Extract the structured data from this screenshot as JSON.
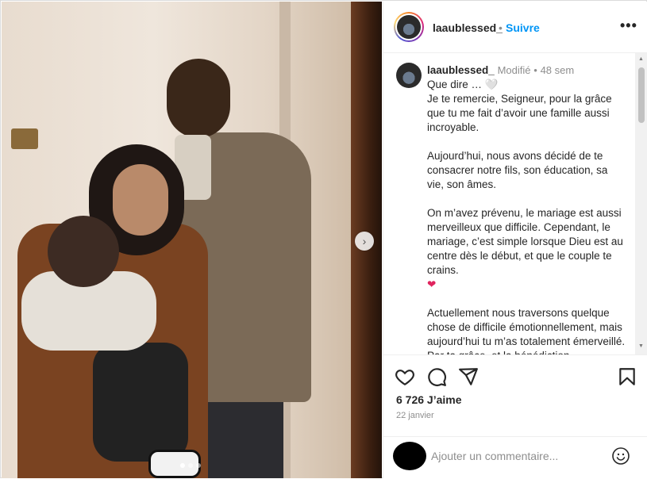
{
  "post": {
    "username": "laaublessed_",
    "follow_label": "Suivre",
    "separator": "•",
    "more_label": "•••"
  },
  "caption": {
    "username": "laaublessed_",
    "edited_label": "Modifié",
    "sep": "•",
    "age": "48 sem",
    "body": "Que dire … 🤍\nJe te remercie, Seigneur, pour la grâce que tu me fait d’avoir une famille aussi incroyable.\n\nAujourd’hui, nous avons décidé de te consacrer notre fils, son éducation, sa vie, son âmes.\n\nOn m’avez prévenu, le mariage est aussi merveilleux que difficile. Cependant, le mariage, c’est simple lorsque Dieu est au centre dès le début, et que le couple te crains.",
    "heart": "❤",
    "body2": "Actuellement nous traversons quelque chose de difficile émotionnellement, mais aujourd’hui tu m’as totalement émerveillé. Par ta grâce, et la bénédiction incommensurable tu m’as"
  },
  "stats": {
    "likes": "6 726 J’aime",
    "date": "22 janvier"
  },
  "comment_box": {
    "placeholder": "Ajouter un commentaire..."
  },
  "carousel": {
    "next_icon": "›",
    "slide_count": 3,
    "active_index": 0
  },
  "icons": [
    "like-icon",
    "comment-icon",
    "share-icon",
    "save-icon",
    "emoji-icon"
  ],
  "colors": {
    "follow": "#0095f6",
    "heart": "#e0245e"
  }
}
